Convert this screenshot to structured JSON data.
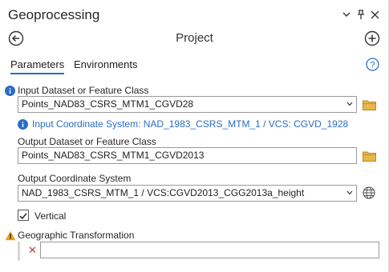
{
  "window": {
    "title": "Geoprocessing"
  },
  "nav": {
    "title": "Project"
  },
  "tabs": [
    {
      "label": "Parameters",
      "active": true
    },
    {
      "label": "Environments",
      "active": false
    }
  ],
  "params": {
    "input_label": "Input Dataset or Feature Class",
    "input_value": "Points_NAD83_CSRS_MTM1_CGVD28",
    "info_message": "Input Coordinate System: NAD_1983_CSRS_MTM_1 / VCS: CGVD_1928",
    "output_label": "Output Dataset or Feature Class",
    "output_value": "Points_NAD83_CSRS_MTM1_CGVD2013",
    "ocs_label": "Output Coordinate System",
    "ocs_value": "NAD_1983_CSRS_MTM_1 / VCS:CGVD2013_CGG2013a_height",
    "vertical_label": "Vertical",
    "vertical_checked": true,
    "gt_label": "Geographic Transformation",
    "gt_value": ""
  },
  "colors": {
    "accent": "#2b6cc4",
    "info": "#2b6cc4",
    "warning": "#e8a317",
    "error": "#d13438",
    "folder": "#e6b84a"
  }
}
